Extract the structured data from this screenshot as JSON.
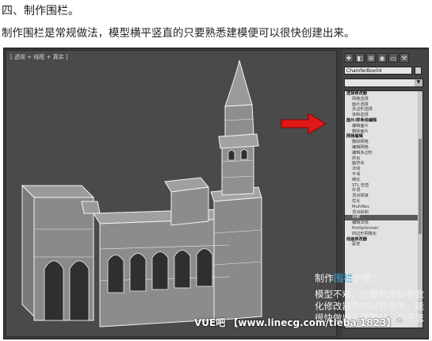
{
  "article": {
    "heading": "四、制作围栏。",
    "subheading": "制作围栏是常规做法，模型横平竖直的只要熟悉建模便可以很快创建出来。"
  },
  "viewport": {
    "label": "[ 透视 + 线框 + 真实 ]"
  },
  "panel": {
    "toolbar_icons": [
      "create-icon",
      "modify-icon",
      "hierarchy-icon",
      "motion-icon",
      "display-icon",
      "utilities-icon"
    ],
    "object_name": "ChamferBox04",
    "modifier_list_label": "修改器列表",
    "list_items": [
      {
        "label": "选择修改器",
        "header": true
      },
      {
        "label": "网格选择"
      },
      {
        "label": "面片选择"
      },
      {
        "label": "多边形选择"
      },
      {
        "label": "体积选择"
      },
      {
        "label": "面片/样条线编辑",
        "header": true
      },
      {
        "label": "编辑面片"
      },
      {
        "label": "删除面片"
      },
      {
        "label": "网格编辑",
        "header": true
      },
      {
        "label": "删除网格"
      },
      {
        "label": "编辑网格"
      },
      {
        "label": "编辑多边形"
      },
      {
        "label": "挤出"
      },
      {
        "label": "面挤出"
      },
      {
        "label": "法线"
      },
      {
        "label": "平滑"
      },
      {
        "label": "细化"
      },
      {
        "label": "STL 检查"
      },
      {
        "label": "补洞"
      },
      {
        "label": "顶点焊接"
      },
      {
        "label": "优化"
      },
      {
        "label": "MultiRes"
      },
      {
        "label": "顶点绘制"
      },
      {
        "label": "对称",
        "selected": true
      },
      {
        "label": "编辑法线"
      },
      {
        "label": "ProOptimizer"
      },
      {
        "label": "四边形网格化"
      },
      {
        "label": "动画修改器",
        "header": true
      },
      {
        "label": "蒙皮"
      }
    ]
  },
  "overlay": {
    "steps_title_prefix": "制作",
    "steps_title_highlight": "围栏",
    "steps_title_suffix": "步骤：",
    "steps_body": "模型不难，但要利用好参数化修改器中的对称命令，能很快做出孔洞部分。至于怎",
    "watermark": "VUE吧 【www.linecg.com/tieba/1823】^"
  },
  "colors": {
    "highlight": "#39a9e0",
    "arrow": "#e01818"
  }
}
